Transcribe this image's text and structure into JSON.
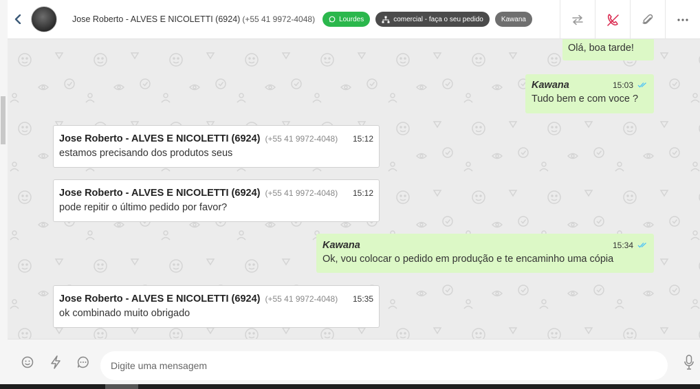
{
  "header": {
    "contact_name": "Jose Roberto - ALVES E NICOLETTI (6924)",
    "contact_phone": "(+55 41 9972-4048)",
    "tags": [
      {
        "label": "Lourdes",
        "icon": "whatsapp-icon",
        "color": "#2bb74c"
      },
      {
        "label": "comercial - faça o seu pedido",
        "icon": "sitemap-icon",
        "color": "#4b4b4b"
      },
      {
        "label": "Kawana",
        "icon": "",
        "color": "#6f6f6f"
      }
    ],
    "actions": [
      "transfer-icon",
      "end-call-icon",
      "attachment-icon",
      "more-icon"
    ]
  },
  "messages": [
    {
      "direction": "out",
      "sender": "",
      "time": "",
      "text": "Olá, boa tarde!"
    },
    {
      "direction": "out",
      "sender": "Kawana",
      "time": "15:03",
      "text": "Tudo bem e com voce ?"
    },
    {
      "direction": "in",
      "sender": "Jose Roberto - ALVES E NICOLETTI (6924)",
      "phone": "(+55 41 9972-4048)",
      "time": "15:12",
      "text": "estamos precisando dos produtos seus"
    },
    {
      "direction": "in",
      "sender": "Jose Roberto - ALVES E NICOLETTI (6924)",
      "phone": "(+55 41 9972-4048)",
      "time": "15:12",
      "text": "pode repitir o último pedido por favor?"
    },
    {
      "direction": "out",
      "sender": "Kawana",
      "time": "15:34",
      "text": "Ok, vou colocar o pedido em produção e te encaminho uma cópia"
    },
    {
      "direction": "in",
      "sender": "Jose Roberto - ALVES E NICOLETTI (6924)",
      "phone": "(+55 41 9972-4048)",
      "time": "15:35",
      "text": "ok combinado muito obrigado"
    }
  ],
  "composer": {
    "placeholder": "Digite uma mensagem",
    "icons": [
      "emoji-icon",
      "lightning-icon",
      "quick-reply-icon",
      "microphone-icon"
    ]
  },
  "colors": {
    "outgoing_bubble": "#dcf8c6",
    "incoming_bubble": "#ffffff",
    "read_ticks": "#4fc3f7",
    "whatsapp_tag": "#2bb74c",
    "end_call": "#d9254c"
  }
}
